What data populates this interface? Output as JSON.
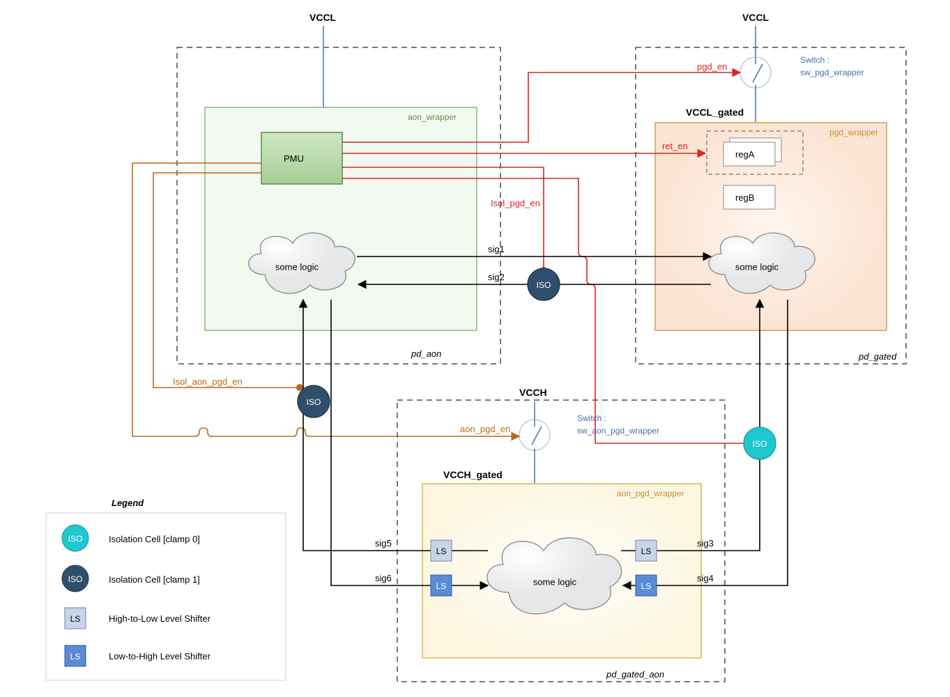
{
  "rails": {
    "vccl_left": "VCCL",
    "vccl_right": "VCCL",
    "vcch": "VCCH",
    "vccl_gated": "VCCL_gated",
    "vcch_gated": "VCCH_gated"
  },
  "domains": {
    "pd_aon": "pd_aon",
    "pd_gated": "pd_gated",
    "pd_gated_aon": "pd_gated_aon"
  },
  "wrappers": {
    "aon": "aon_wrapper",
    "pgd": "pgd_wrapper",
    "aon_pgd": "aon_pgd_wrapper"
  },
  "switches": {
    "pgd": {
      "t": "Switch :",
      "n": "sw_pgd_wrapper"
    },
    "aon_pgd": {
      "t": "Switch :",
      "n": "sw_aon_pgd_wrapper"
    }
  },
  "pmu": "PMU",
  "regs": {
    "a": "regA",
    "b": "regB"
  },
  "logic": "some logic",
  "controls": {
    "pgd_en": "pgd_en",
    "ret_en": "ret_en",
    "isol_pgd_en": "Isol_pgd_en",
    "aon_pgd_en": "aon_pgd_en",
    "isol_aon_pgd_en": "Isol_aon_pgd_en"
  },
  "sigs": {
    "s1": "sig1",
    "s2": "sig2",
    "s3": "sig3",
    "s4": "sig4",
    "s5": "sig5",
    "s6": "sig6"
  },
  "iso": "ISO",
  "ls": "LS",
  "legend": {
    "title": "Legend",
    "iso0": "Isolation Cell [clamp 0]",
    "iso1": "Isolation Cell [clamp 1]",
    "ls_hl": "High-to-Low Level Shifter",
    "ls_lh": "Low-to-High Level Shifter"
  }
}
